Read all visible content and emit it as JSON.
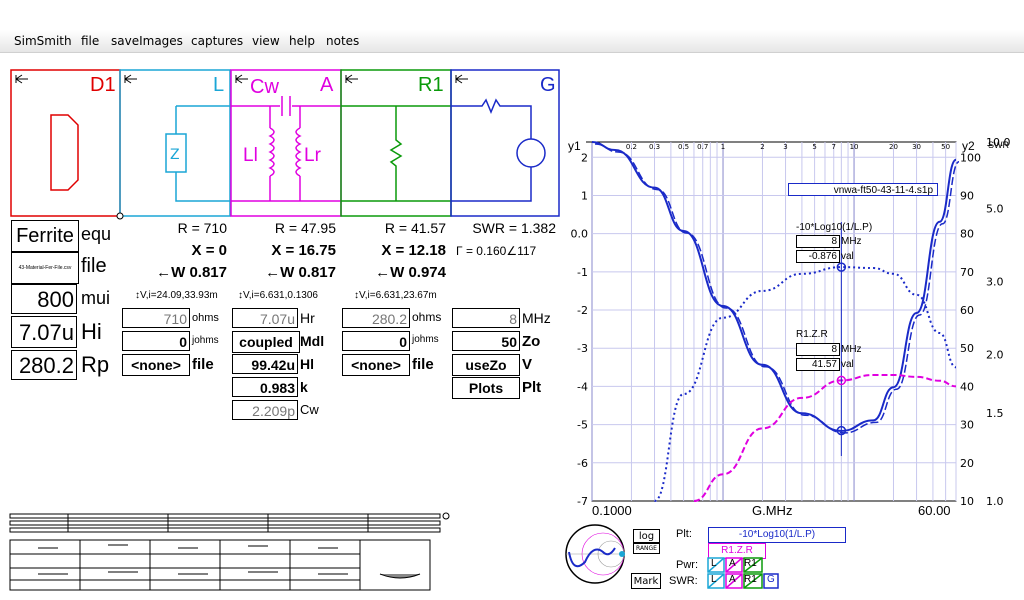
{
  "menu": [
    "SimSmith",
    "file",
    "saveImages",
    "captures",
    "view",
    "help",
    "notes"
  ],
  "components": {
    "D1": {
      "name": "D1",
      "color": "#e00000"
    },
    "L": {
      "name": "L",
      "color": "#1aa6d6"
    },
    "A": {
      "name": "A",
      "sub": "Cw",
      "labels": [
        "Ll",
        "Lr"
      ],
      "color": "#e000e0"
    },
    "R1": {
      "name": "R1",
      "color": "#0a9a0a"
    },
    "G": {
      "name": "G",
      "color": "#1a2ac8"
    }
  },
  "load": {
    "type": "Ferrite",
    "type_label": "equ",
    "file_value": "43-Material-Fer-File.csv",
    "file_label": "file",
    "mui_value": "800",
    "mui_label": "mui",
    "hi_value": "7.07u",
    "hi_label": "Hi",
    "rp_value": "280.2",
    "rp_label": "Rp"
  },
  "L_col": {
    "R": "R = 710",
    "X": "X = 0",
    "W": "←W 0.817",
    "V": "↕V,i=24.09,33.93m",
    "ohms_value": "710",
    "ohms_label": "ohms",
    "johms_value": "0",
    "johms_label": "johms",
    "file_value": "<none>",
    "file_label": "file"
  },
  "A_col": {
    "R": "R = 47.95",
    "X": "X = 16.75",
    "W": "←W 0.817",
    "V": "↕V,i=6.631,0.1306",
    "hr_value": "7.07u",
    "hr_label": "Hr",
    "mdl_value": "coupled",
    "mdl_label": "Mdl",
    "hl_value": "99.42u",
    "hl_label": "Hl",
    "k_value": "0.983",
    "k_label": "k",
    "cw_value": "2.209p",
    "cw_label": "Cw"
  },
  "R1_col": {
    "R": "R = 41.57",
    "X": "X = 12.18",
    "W": "←W 0.974",
    "V": "↕V,i=6.631,23.67m",
    "ohms_value": "280.2",
    "ohms_label": "ohms",
    "johms_value": "0",
    "johms_label": "johms",
    "file_value": "<none>",
    "file_label": "file"
  },
  "G_col": {
    "SWR": "SWR = 1.382",
    "gamma": "Γ = 0.160∠117",
    "mhz_value": "8",
    "mhz_label": "MHz",
    "zo_value": "50",
    "zo_label": "Zo",
    "v_value": "useZo",
    "v_label": "V",
    "plt_value": "Plots",
    "plt_label": "Plt"
  },
  "chart_data": {
    "type": "line",
    "x_axis_label": "G.MHz",
    "x_min_label": "0.1000",
    "x_max_label": "60.00",
    "x_scale": "log",
    "x_ticks_top": [
      "0.2",
      "0.3",
      "0.5",
      "0.7",
      "1",
      "2",
      "3",
      "5",
      "7",
      "10",
      "20",
      "30",
      "50"
    ],
    "y1_label": "y1",
    "y1_ticks": [
      "2",
      "1",
      "0.0",
      "-1",
      "-2",
      "-3",
      "-4",
      "-5",
      "-6",
      "-7"
    ],
    "y2_label": "y2",
    "y2_ticks": [
      "100",
      "90",
      "80",
      "70",
      "60",
      "50",
      "40",
      "30",
      "20",
      "10"
    ],
    "swr_label": "SWR",
    "swr_ticks": [
      "10.0",
      "5.0",
      "3.0",
      "2.0",
      "1.5",
      "1.0"
    ],
    "file_name": "vnwa-ft50-43-11-4.s1p",
    "markers": [
      {
        "trace": "-10*Log10(1/L.P)",
        "freq": "8",
        "freq_unit": "MHz",
        "value": "-0.876",
        "value_unit": "val"
      },
      {
        "trace": "R1.Z.R",
        "freq": "8",
        "freq_unit": "MHz",
        "value": "41.57",
        "value_unit": "val"
      }
    ],
    "series": [
      {
        "name": "-10*Log10(1/L.P)",
        "color": "#1a2ac8",
        "style": "dotted",
        "axis": "y1",
        "x": [
          0.3,
          0.5,
          1,
          2,
          4,
          8,
          14,
          20,
          30,
          45,
          60
        ],
        "y": [
          -7,
          -4.2,
          -2.2,
          -1.5,
          -1.05,
          -0.876,
          -0.9,
          -1.05,
          -1.6,
          -2.6,
          -3.5
        ]
      },
      {
        "name": "SWR",
        "color": "#1a2ac8",
        "style": "solid",
        "axis": "swr",
        "x": [
          0.1,
          0.15,
          0.3,
          0.5,
          1,
          2,
          4,
          8,
          14,
          20,
          30,
          45,
          60
        ],
        "y": [
          10,
          9,
          6,
          4.2,
          2.6,
          1.9,
          1.5,
          1.38,
          1.45,
          1.7,
          2.5,
          4.5,
          8
        ]
      },
      {
        "name": "R1.Z.R",
        "color": "#e000e0",
        "style": "dashed",
        "axis": "y2",
        "x": [
          0.6,
          1,
          2,
          4,
          8,
          14,
          20,
          30,
          45,
          60
        ],
        "y": [
          10,
          17,
          29,
          37,
          41.57,
          43,
          43,
          42.5,
          41.5,
          40
        ]
      }
    ]
  },
  "bottom": {
    "log_label": "log",
    "range_label": "RANGE",
    "mark_label": "Mark",
    "plt_label": "Plt:",
    "plt_trace1": "-10*Log10(1/L.P)",
    "plt_trace2": "R1.Z.R",
    "pwr_label": "Pwr:",
    "swr_label": "SWR:",
    "pwr_cells": [
      "L",
      "A",
      "R1"
    ],
    "swr_cells": [
      "L",
      "A",
      "R1",
      "G"
    ]
  }
}
